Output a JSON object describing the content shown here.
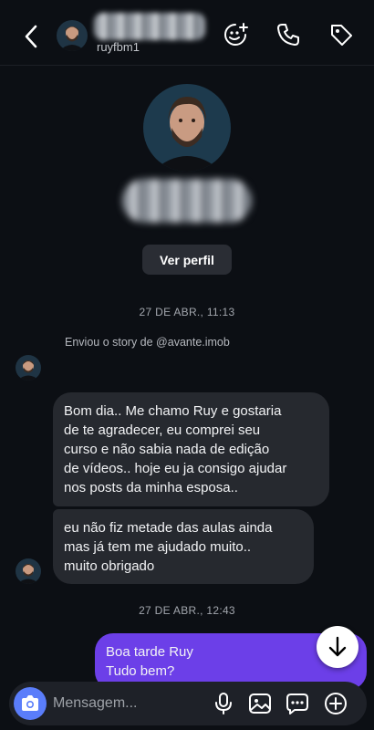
{
  "header": {
    "username": "ruyfbm1",
    "icons": [
      "back-chevron-icon",
      "avatar",
      "add-person-icon",
      "phone-icon",
      "tag-icon"
    ]
  },
  "profile": {
    "view_profile_label": "Ver perfil"
  },
  "conversation": {
    "timestamp_1": "27 DE ABR., 11:13",
    "story_note": "Enviou o story de @avante.imob",
    "message_1": [
      "Bom dia.. Me chamo Ruy e gostaria",
      "de te agradecer, eu comprei seu",
      "curso e não sabia nada de edição",
      "de vídeos.. hoje eu ja consigo ajudar",
      "nos posts da minha esposa.."
    ],
    "message_2": [
      "eu não fiz metade das aulas ainda",
      "mas já tem me ajudado muito..",
      "muito obrigado"
    ],
    "timestamp_2": "27 DE ABR., 12:43",
    "message_3": [
      "Boa tarde Ruy",
      "Tudo bem?"
    ]
  },
  "composer": {
    "placeholder": "Mensagem...",
    "icons": [
      "camera-icon",
      "microphone-icon",
      "gallery-icon",
      "sticker-icon",
      "plus-icon"
    ]
  },
  "colors": {
    "background": "#0c0f14",
    "incoming_bubble": "#26292f",
    "outgoing_bubble": "#6c3fe8",
    "camera_button": "#5a7dfa"
  }
}
